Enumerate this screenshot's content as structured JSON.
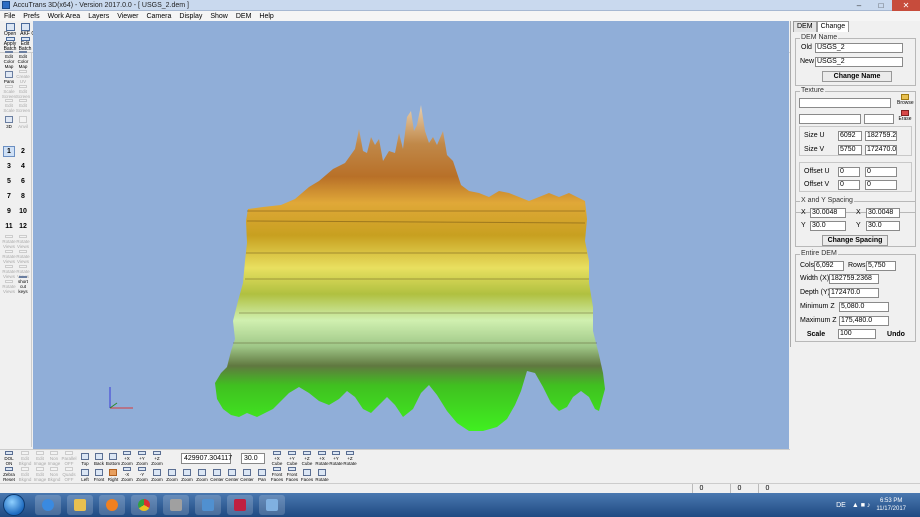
{
  "window": {
    "title": "AccuTrans 3D(x64) - Version 2017.0.0 - [ USGS_2.dem ]"
  },
  "menu": [
    "File",
    "Prefs",
    "Work Area",
    "Layers",
    "Viewer",
    "Camera",
    "Display",
    "Show",
    "DEM",
    "Help"
  ],
  "toolbar": {
    "row1": [
      "Open",
      "AKF",
      "Options",
      "Reload",
      "Batch",
      "Multi",
      "Text",
      "Model",
      "Merge Add",
      "Save",
      "As",
      "Options",
      "Bitmap",
      "Close",
      "Adjust Object",
      "Adjust Object",
      "Center Object",
      "Edit Object",
      "Scale Objects",
      "STA",
      "Help"
    ],
    "row2": [
      "Apply Batch",
      "Edit Batch",
      "Apply Batch",
      "Delete Batch",
      "Replace Batch",
      "Edit Layers",
      "Select Layers",
      "Modify Screen",
      "Modify Screen",
      "Erase Screen",
      "Merge Vertices",
      "Merge All",
      "Merge Select",
      "Merge Sales",
      "Align Normals",
      "Reverse Normals",
      "Reverse All",
      "Normal Scale"
    ]
  },
  "lefttools": {
    "icons": [
      "Edit Color Map",
      "Edit Color Map",
      "Pans",
      "Create UV",
      "Scale Screen",
      "Edit Screen",
      "Edit Scale",
      "Edit Screen",
      "3D",
      "Anvil"
    ],
    "numbers": [
      "1",
      "2",
      "3",
      "4",
      "5",
      "6",
      "7",
      "8",
      "9",
      "10",
      "11",
      "12"
    ],
    "lower": [
      "Rotate Views",
      "Rotate Views",
      "Rotate Views",
      "Rotate Views",
      "Rotate Views",
      "Rotate Views",
      "Rotate Views",
      "short cut keys"
    ]
  },
  "panel": {
    "tabs": [
      "DEM",
      "Change"
    ],
    "dem_name": {
      "title": "DEM Name",
      "old_label": "Old",
      "old_value": "USGS_2",
      "new_label": "New",
      "new_value": "USGS_2",
      "change_button": "Change Name"
    },
    "texture": {
      "title": "Texture",
      "browse": "Browse",
      "erase": "Erase",
      "size_u_label": "Size U",
      "size_u_a": "6092",
      "size_u_b": "182759.236",
      "size_v_label": "Size V",
      "size_v_a": "5750",
      "size_v_b": "172470.0",
      "offset_u_label": "Offset U",
      "offset_u_a": "0",
      "offset_u_b": "0",
      "offset_v_label": "Offset V",
      "offset_v_a": "0",
      "offset_v_b": "0"
    },
    "spacing": {
      "title": "X and Y Spacing",
      "x_label": "X",
      "x_old": "30.0048",
      "x2_label": "X",
      "x_new": "30.0048",
      "y_label": "Y",
      "y_old": "30.0",
      "y2_label": "Y",
      "y_new": "30.0",
      "change_button": "Change Spacing"
    },
    "entire": {
      "title": "Entire DEM",
      "cols_label": "Cols",
      "cols_value": "6,092",
      "rows_label": "Rows",
      "rows_value": "5,750",
      "width_label": "Width (X)",
      "width_value": "182759.2368",
      "depth_label": "Depth (Y)",
      "depth_value": "172470.0",
      "minz_label": "Minimum Z",
      "minz_value": "5,080.0",
      "maxz_label": "Maximum Z",
      "maxz_value": "175,480.0",
      "scale_button": "Scale",
      "scale_value": "100",
      "undo_button": "Undo"
    }
  },
  "bottombar": {
    "row1": [
      "DOL ON",
      "Edit Bkgnd",
      "Edit Image",
      "Non Image",
      "Parallel OFF",
      "Top",
      "Back",
      "Bottom",
      "+X Zoom",
      "+Y Zoom",
      "+Z Zoom",
      "+X Cube",
      "+Y Cube",
      "+Z Cube",
      "+X Rotate",
      "+Y Rotate",
      "+Z Rotate"
    ],
    "row2": [
      "Zebra Reset",
      "Edit Bkgnd",
      "Edit Image",
      "Non Bkgnd",
      "Quads OFF",
      "Left",
      "Front",
      "Right",
      "-X Zoom",
      "-Y Zoom",
      "Zoom",
      "Zoom",
      "Zoom",
      "Zoom",
      "Center",
      "Center",
      "Center",
      "Pan",
      "Front Faces",
      "Front Faces",
      "Faces",
      "Rotate"
    ],
    "coord_value": "429907.304117",
    "step_value": "30.0"
  },
  "status": {
    "cells": [
      "0",
      "0",
      "0"
    ]
  },
  "clock": {
    "time": "6:53 PM",
    "date": "11/17/2017"
  },
  "tray": {
    "lang": "DE"
  },
  "colors": {
    "viewport_bg": "#90aed8",
    "terrain_top": "#c08840",
    "terrain_mid": "#d8c840",
    "terrain_low": "#a8d890",
    "terrain_green": "#30e020"
  }
}
